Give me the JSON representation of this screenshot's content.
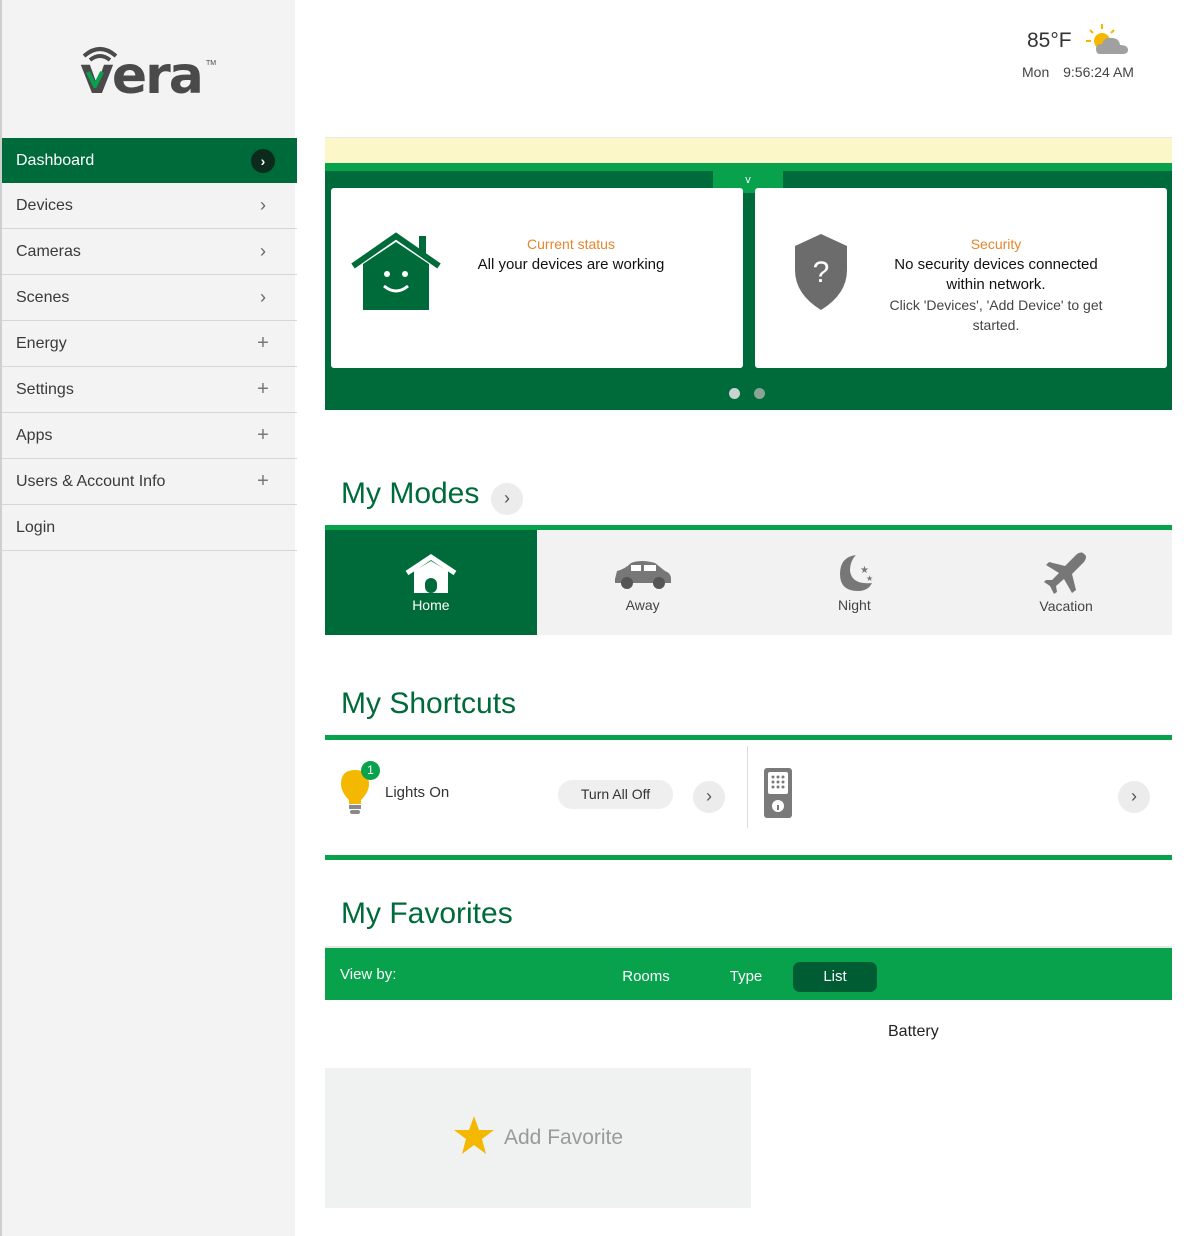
{
  "brand": {
    "logo_text": "vera",
    "tm": "TM"
  },
  "sidebar": {
    "items": [
      {
        "label": "Dashboard",
        "icon": "chevron-right-icon",
        "active": true
      },
      {
        "label": "Devices",
        "icon": "chevron-right-icon"
      },
      {
        "label": "Cameras",
        "icon": "chevron-right-icon"
      },
      {
        "label": "Scenes",
        "icon": "chevron-right-icon"
      },
      {
        "label": "Energy",
        "icon": "plus-icon"
      },
      {
        "label": "Settings",
        "icon": "plus-icon"
      },
      {
        "label": "Apps",
        "icon": "plus-icon"
      },
      {
        "label": "Users & Account Info",
        "icon": "plus-icon"
      },
      {
        "label": "Login",
        "icon": ""
      }
    ]
  },
  "weather": {
    "temperature": "85°F",
    "day": "Mon",
    "time": "9:56:24 AM",
    "icon": "partly-cloudy-icon"
  },
  "status_panel": {
    "toggle_label": "v",
    "cards": [
      {
        "title": "Current status",
        "text": "All your devices are working",
        "icon": "smiling-house-icon"
      },
      {
        "title": "Security",
        "text_line1": "No security devices connected",
        "text_line2": "within network.",
        "sub_line1": "Click 'Devices', 'Add Device' to get",
        "sub_line2": "started.",
        "icon": "shield-question-icon"
      }
    ]
  },
  "modes": {
    "title": "My Modes",
    "items": [
      {
        "label": "Home",
        "icon": "home-icon",
        "active": true
      },
      {
        "label": "Away",
        "icon": "car-icon"
      },
      {
        "label": "Night",
        "icon": "moon-icon"
      },
      {
        "label": "Vacation",
        "icon": "airplane-icon"
      }
    ]
  },
  "shortcuts": {
    "title": "My Shortcuts",
    "lights_label": "Lights On",
    "lights_count": "1",
    "turn_off_label": "Turn All Off"
  },
  "favorites": {
    "title": "My Favorites",
    "view_by_label": "View by:",
    "options": [
      "Rooms",
      "Type",
      "List"
    ],
    "active_option": "List",
    "group_label": "Battery",
    "add_label": "Add Favorite"
  },
  "colors": {
    "dark_green": "#006b3a",
    "bright_green": "#08a14c",
    "status_orange": "#e6852d",
    "star_yellow": "#f5b800"
  }
}
